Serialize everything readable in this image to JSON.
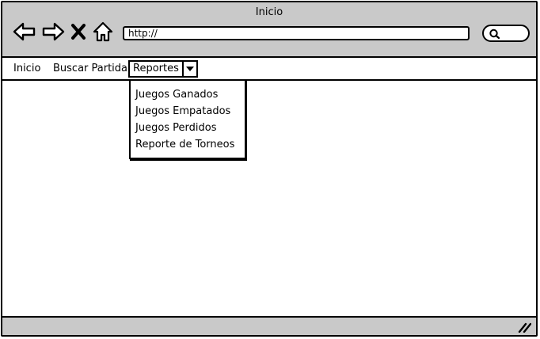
{
  "window": {
    "title": "Inicio"
  },
  "toolbar": {
    "back_icon": "back-arrow-icon",
    "forward_icon": "forward-arrow-icon",
    "stop_icon": "close-x-icon",
    "home_icon": "home-icon",
    "address_value": "http://",
    "search_icon": "search-icon"
  },
  "menu": {
    "items": [
      {
        "label": "Inicio"
      },
      {
        "label": "Buscar Partida"
      },
      {
        "label": "Reportes"
      }
    ]
  },
  "dropdown": {
    "items": [
      {
        "label": "Juegos Ganados"
      },
      {
        "label": "Juegos Empatados"
      },
      {
        "label": "Juegos Perdidos"
      },
      {
        "label": "Reporte de Torneos"
      }
    ]
  },
  "colors": {
    "chrome": "#c9c9c9",
    "border": "#000000",
    "content": "#ffffff"
  }
}
